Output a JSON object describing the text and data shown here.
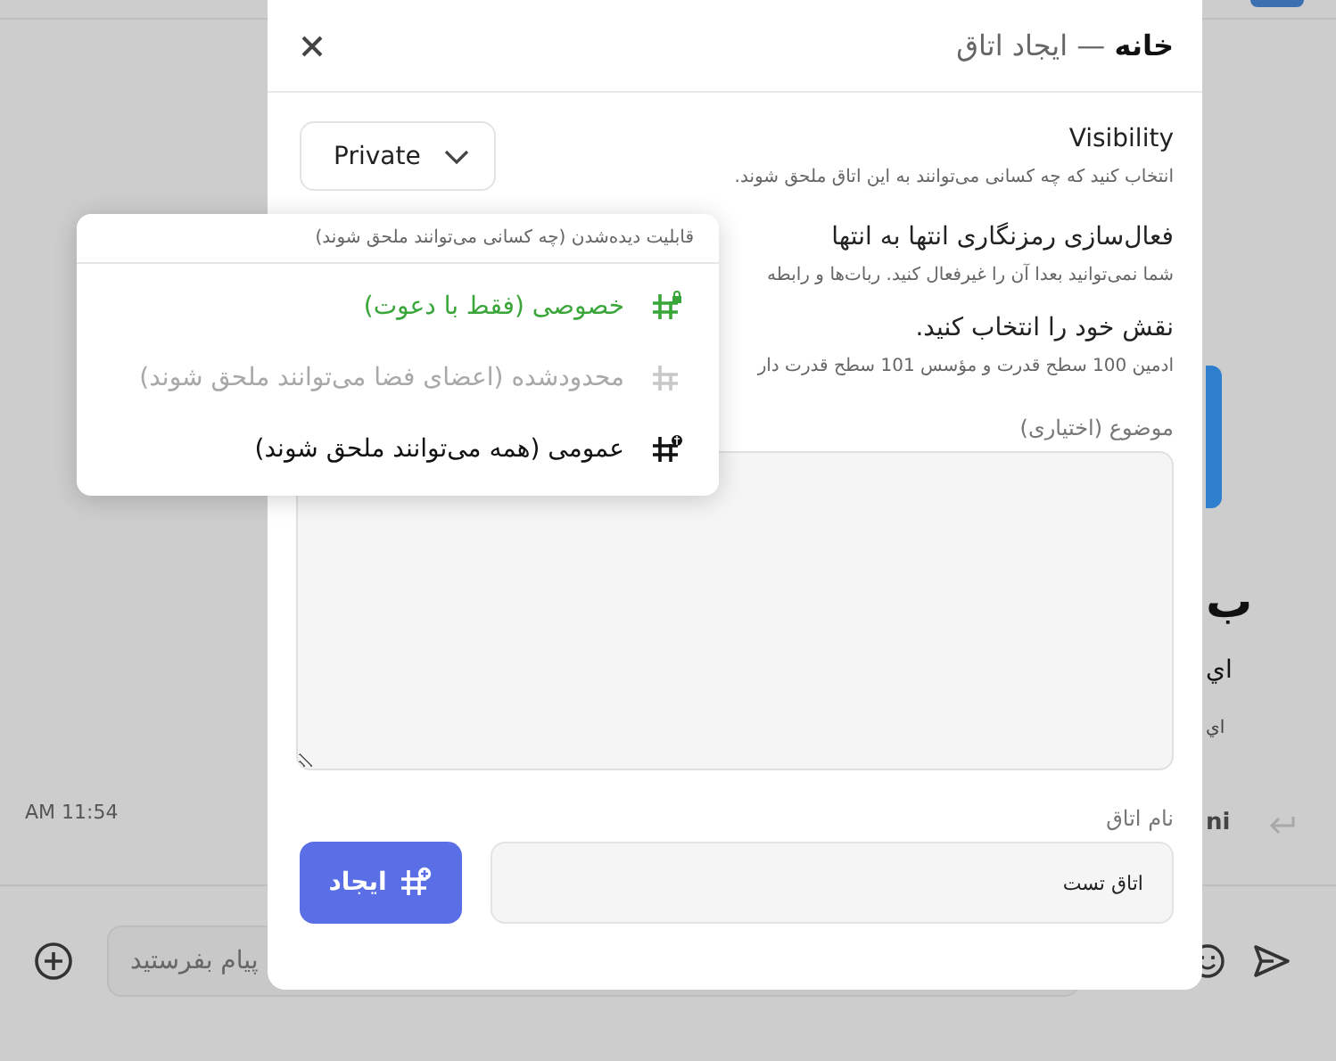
{
  "background": {
    "time": "AM 11:54",
    "sender": "ni",
    "fragments": [
      "ب",
      "اي",
      "اي"
    ],
    "composer": {
      "placeholder": "پیام بفرستید"
    }
  },
  "dialog": {
    "title": "**خانه** — ایجاد اتاق",
    "visibility": {
      "label": "Visibility",
      "description": "انتخاب کنید که چه کسانی می‌توانند به این اتاق ملحق شوند.",
      "value": "Private"
    },
    "encryption": {
      "label": "فعال‌سازی رمزنگاری انتها به انتها",
      "description": "شما نمی‌توانید بعدا آن را غیرفعال کنید. ربات‌ها و رابطه"
    },
    "role": {
      "label": "نقش خود را انتخاب کنید.",
      "description": "ادمین 100 سطح قدرت و مؤسس 101 سطح قدرت دار"
    },
    "topic": {
      "label": "موضوع (اختیاری)"
    },
    "room_name": {
      "label": "نام اتاق",
      "value": "اتاق تست"
    },
    "create_button": "ایجاد",
    "menu": {
      "heading": "قابلیت دیده‌شدن (چه کسانی می‌توانند ملحق شوند)",
      "options": [
        {
          "kind": "private",
          "label": "خصوصی (فقط با دعوت)",
          "selected": true,
          "disabled": false
        },
        {
          "kind": "restricted",
          "label": "محدودشده (اعضای فضا می‌توانند ملحق شوند)",
          "selected": false,
          "disabled": true
        },
        {
          "kind": "public",
          "label": "عمومی (همه می‌توانند ملحق شوند)",
          "selected": false,
          "disabled": false
        }
      ]
    }
  }
}
